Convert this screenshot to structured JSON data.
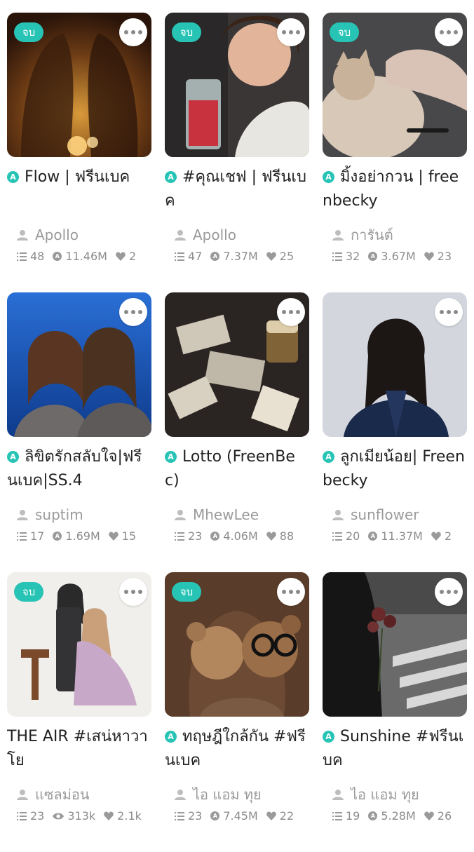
{
  "colors": {
    "accent": "#27c4b5",
    "muted": "#8c8c8c"
  },
  "badge_label": "จบ",
  "books": [
    {
      "title": "Flow | ฟรีนเบค",
      "author": "Apollo",
      "chapters": "48",
      "reads": "11.46M",
      "likes": "2",
      "finished": true,
      "a_icon": true,
      "read_icon": "reads-icon"
    },
    {
      "title": "#คุณเชฟ | ฟรีนเบค",
      "author": "Apollo",
      "chapters": "47",
      "reads": "7.37M",
      "likes": "25",
      "finished": true,
      "a_icon": true,
      "read_icon": "reads-icon"
    },
    {
      "title": "มิ้งอย่ากวน | freenbecky",
      "author": "การันต์",
      "chapters": "32",
      "reads": "3.67M",
      "likes": "23",
      "finished": true,
      "a_icon": true,
      "read_icon": "reads-icon"
    },
    {
      "title": "ลิขิตรักสลับใจ|ฟรีนเบค|SS.4",
      "author": "suptim",
      "chapters": "17",
      "reads": "1.69M",
      "likes": "15",
      "finished": false,
      "a_icon": true,
      "read_icon": "reads-icon"
    },
    {
      "title": "Lotto (FreenBec)",
      "author": "MhewLee",
      "chapters": "23",
      "reads": "4.06M",
      "likes": "88",
      "finished": false,
      "a_icon": true,
      "read_icon": "reads-icon"
    },
    {
      "title": "ลูกเมียน้อย| Freenbecky",
      "author": "sunflower",
      "chapters": "20",
      "reads": "11.37M",
      "likes": "2",
      "finished": false,
      "a_icon": true,
      "read_icon": "reads-icon"
    },
    {
      "title": "THE AIR #เสน่หาวาโย",
      "author": "แซลม่อน",
      "chapters": "23",
      "reads": "313k",
      "likes": "2.1k",
      "finished": true,
      "a_icon": false,
      "read_icon": "eye-icon"
    },
    {
      "title": "ทฤษฎีใกล้กัน #ฟรีนเบค",
      "author": "ไอ แอม ทุย",
      "chapters": "23",
      "reads": "7.45M",
      "likes": "22",
      "finished": true,
      "a_icon": true,
      "read_icon": "reads-icon"
    },
    {
      "title": "Sunshine #ฟรีนเบค",
      "author": "ไอ แอม ทุย",
      "chapters": "19",
      "reads": "5.28M",
      "likes": "26",
      "finished": false,
      "a_icon": true,
      "read_icon": "reads-icon"
    }
  ]
}
